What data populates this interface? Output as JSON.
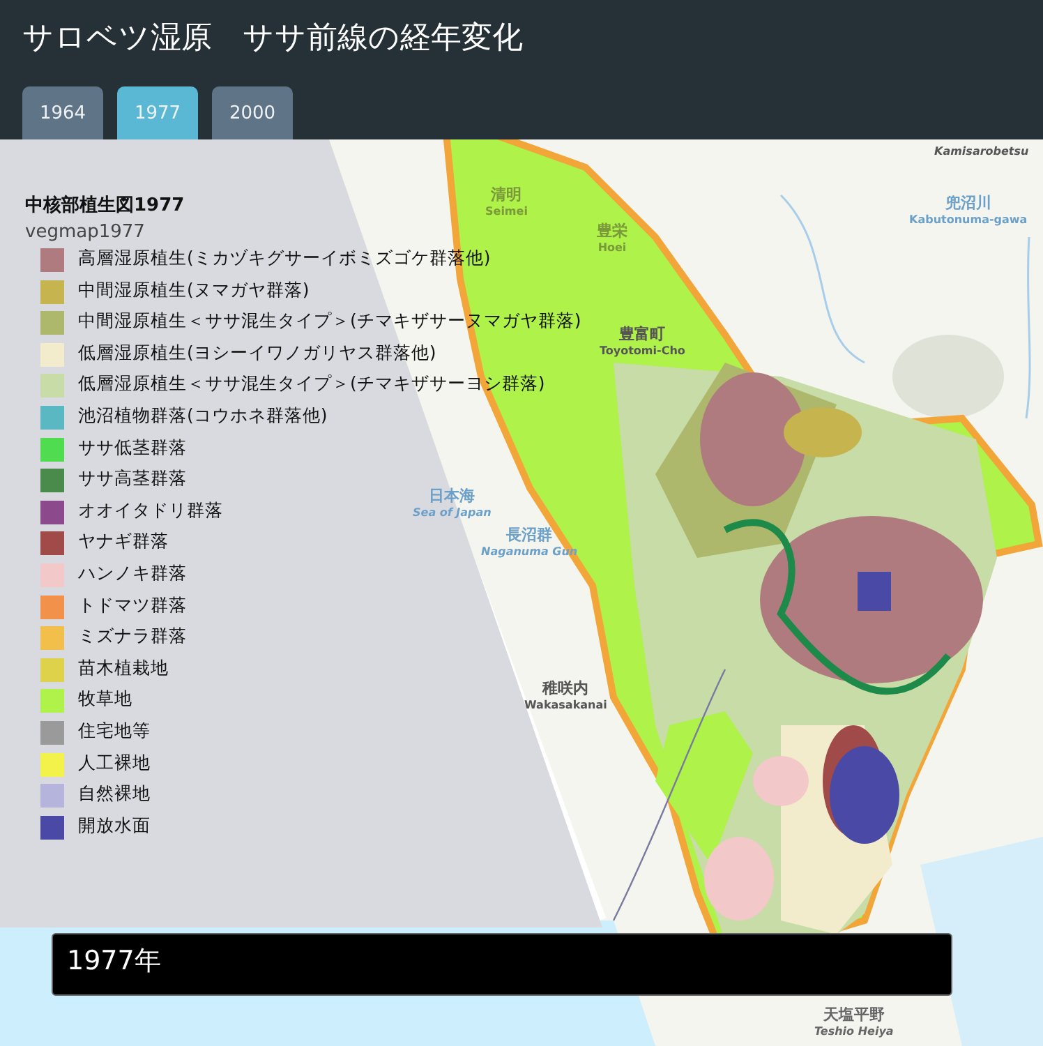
{
  "header": {
    "title": "サロベツ湿原　ササ前線の経年変化"
  },
  "tabs": [
    {
      "label": "1964",
      "selected": false
    },
    {
      "label": "1977",
      "selected": true
    },
    {
      "label": "2000",
      "selected": false
    }
  ],
  "map_labels": [
    {
      "romaji": "Kamisarobetsu"
    },
    {
      "name": "清明",
      "romaji": "Seimei"
    },
    {
      "name": "豊栄",
      "romaji": "Hoei"
    },
    {
      "name": "兜沼川",
      "romaji": "Kabutonuma-gawa"
    },
    {
      "name": "豊富町",
      "romaji": "Toyotomi-Cho"
    },
    {
      "name": "日本海",
      "romaji": "Sea of Japan"
    },
    {
      "name": "長沼群",
      "romaji": "Naganuma Gun"
    },
    {
      "name": "稚咲内",
      "romaji": "Wakasakanai"
    },
    {
      "name": "天塩平野",
      "romaji": "Teshio Heiya"
    }
  ],
  "legend": {
    "title": "中核部植生図1977",
    "layer": "vegmap1977",
    "items": [
      {
        "label": "高層湿原植生(ミカヅキグサーイボミズゴケ群落他)",
        "color": "#b07b7e"
      },
      {
        "label": "中間湿原植生(ヌマガヤ群落)",
        "color": "#c6b44f"
      },
      {
        "label": "中間湿原植生＜ササ混生タイプ＞(チマキザサーヌマガヤ群落)",
        "color": "#adb86c"
      },
      {
        "label": "低層湿原植生(ヨシーイワノガリヤス群落他)",
        "color": "#f3eccc"
      },
      {
        "label": "低層湿原植生＜ササ混生タイプ＞(チマキザサーヨシ群落)",
        "color": "#c7dca6"
      },
      {
        "label": "池沼植物群落(コウホネ群落他)",
        "color": "#5ab8c2"
      },
      {
        "label": "ササ低茎群落",
        "color": "#4fdc4f"
      },
      {
        "label": "ササ高茎群落",
        "color": "#4a8a4a"
      },
      {
        "label": "オオイタドリ群落",
        "color": "#8c4a8c"
      },
      {
        "label": "ヤナギ群落",
        "color": "#a04a4a"
      },
      {
        "label": "ハンノキ群落",
        "color": "#f2c8c8"
      },
      {
        "label": "トドマツ群落",
        "color": "#f2924a"
      },
      {
        "label": "ミズナラ群落",
        "color": "#f2c04a"
      },
      {
        "label": "苗木植栽地",
        "color": "#ded24a"
      },
      {
        "label": "牧草地",
        "color": "#aef24a"
      },
      {
        "label": "住宅地等",
        "color": "#9a9a9a"
      },
      {
        "label": "人工裸地",
        "color": "#f2f24a"
      },
      {
        "label": "自然裸地",
        "color": "#b4b4dc"
      },
      {
        "label": "開放水面",
        "color": "#4a4aa6"
      }
    ]
  },
  "caption": "1977年"
}
